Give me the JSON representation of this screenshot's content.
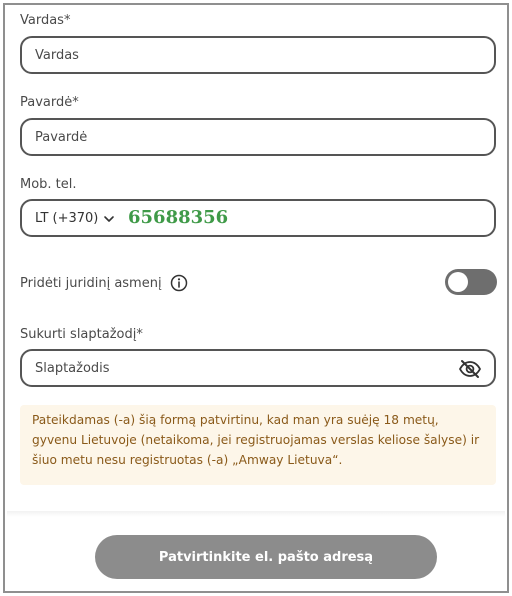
{
  "form": {
    "first_name": {
      "label": "Vardas*",
      "placeholder": "Vardas"
    },
    "last_name": {
      "label": "Pavardė*",
      "placeholder": "Pavardė"
    },
    "phone": {
      "label": "Mob. tel.",
      "country_code": "LT (+370)",
      "value": "65688356"
    },
    "legal_entity": {
      "label": "Pridėti juridinį asmenį",
      "toggle_on": false
    },
    "password": {
      "label": "Sukurti slaptažodį*",
      "placeholder": "Slaptažodis"
    },
    "notice": "Pateikdamas (-a) šią formą patvirtinu, kad man yra suėję 18 metų, gyvenu Lietuvoje (netaikoma, jei registruojamas verslas keliose šalyse) ir šiuo metu nesu registruotas (-a) „Amway Lietuva“.",
    "submit_label": "Patvirtinkite el. pašto adresą"
  },
  "icons": {
    "info": "info-icon",
    "eye_off": "eye-off-icon",
    "chevron": "chevron-down-icon"
  },
  "colors": {
    "phone_number": "#3f9a48",
    "notice_bg": "#fdf6e9",
    "notice_text": "#8a5a1a",
    "button_bg": "#8c8c8c"
  }
}
